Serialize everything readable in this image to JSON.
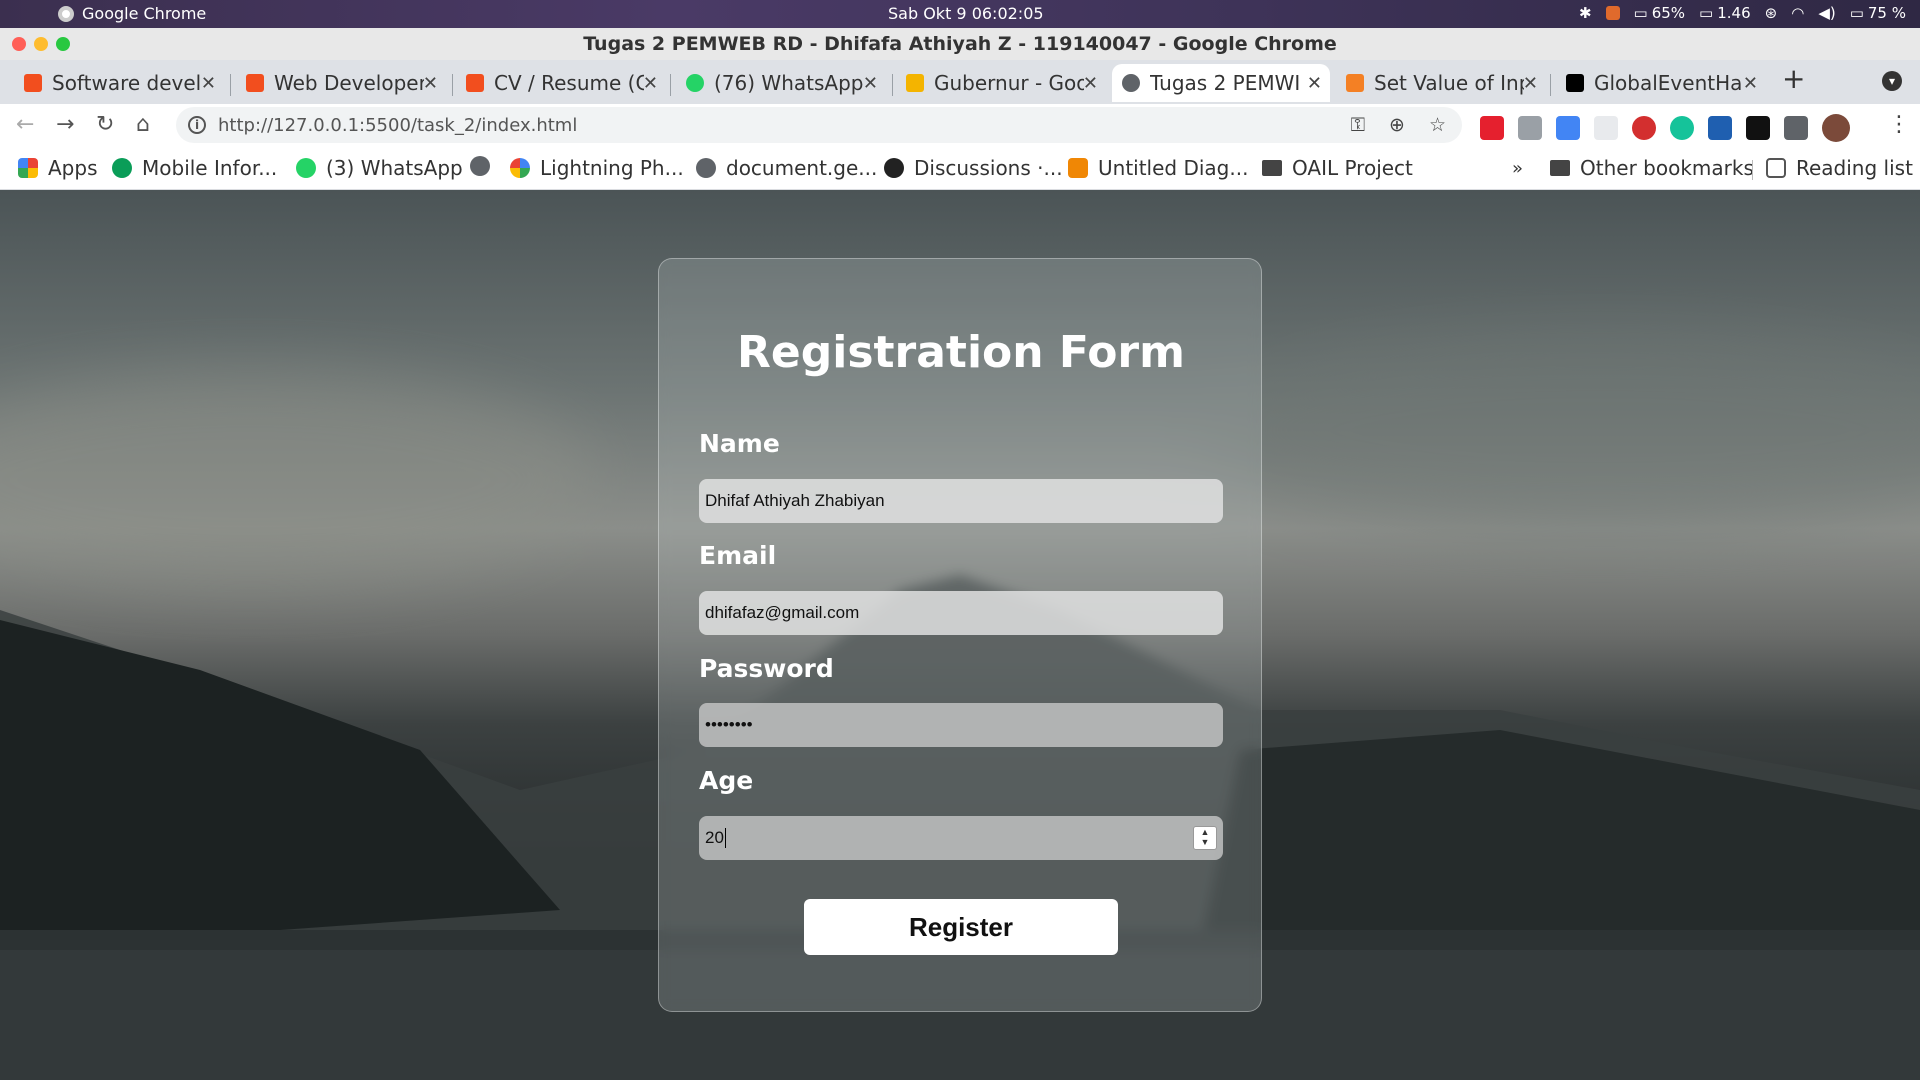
{
  "os_bar": {
    "app_name": "Google Chrome",
    "clock": "Sab Okt 9  06:02:05",
    "battery_percent_1": "65%",
    "load": "1.46",
    "battery_percent_2": "75 %"
  },
  "window": {
    "title": "Tugas 2 PEMWEB RD - Dhifafa Athiyah Z - 119140047 - Google Chrome"
  },
  "tabs": [
    {
      "label": "Software devel",
      "favicon_color": "#f24e1e",
      "icon": "figma-icon"
    },
    {
      "label": "Web Developer",
      "favicon_color": "#f24e1e",
      "icon": "figma-icon"
    },
    {
      "label": "CV / Resume (C",
      "favicon_color": "#f24e1e",
      "icon": "figma-icon"
    },
    {
      "label": "(76) WhatsApp",
      "favicon_color": "#25d366",
      "icon": "whatsapp-icon"
    },
    {
      "label": "Gubernur - Goo",
      "favicon_color": "#f4b400",
      "icon": "slides-icon"
    },
    {
      "label": "Tugas 2 PEMWI",
      "favicon_color": "#5f6368",
      "icon": "globe-icon",
      "active": true
    },
    {
      "label": "Set Value of Inp",
      "favicon_color": "#f48024",
      "icon": "stackoverflow-icon"
    },
    {
      "label": "GlobalEventHa",
      "favicon_color": "#000000",
      "icon": "mdn-icon"
    }
  ],
  "toolbar": {
    "url_host": "http://127.0.0.1",
    "url_path": ":5500/task_2/index.html"
  },
  "bookmarks": {
    "apps": "Apps",
    "items": [
      {
        "label": "Mobile Infor...",
        "icon": "mobile-icon"
      },
      {
        "label": "(3) WhatsApp",
        "icon": "whatsapp-icon"
      },
      {
        "label": "",
        "icon": "globe-icon"
      },
      {
        "label": "Lightning Ph...",
        "icon": "google-icon"
      },
      {
        "label": "document.ge...",
        "icon": "globe-icon"
      },
      {
        "label": "Discussions ·...",
        "icon": "github-icon"
      },
      {
        "label": "Untitled Diag...",
        "icon": "drawio-icon"
      },
      {
        "label": "OAIL Project",
        "icon": "folder-icon"
      }
    ],
    "overflow": "»",
    "other": "Other bookmarks",
    "reading_list": "Reading list"
  },
  "form": {
    "title": "Registration Form",
    "name_label": "Name",
    "name_value": "Dhifaf Athiyah Zhabiyan",
    "email_label": "Email",
    "email_value": "dhifafaz@gmail.com",
    "password_label": "Password",
    "password_value": "••••••••",
    "age_label": "Age",
    "age_value": "20",
    "register_label": "Register"
  }
}
